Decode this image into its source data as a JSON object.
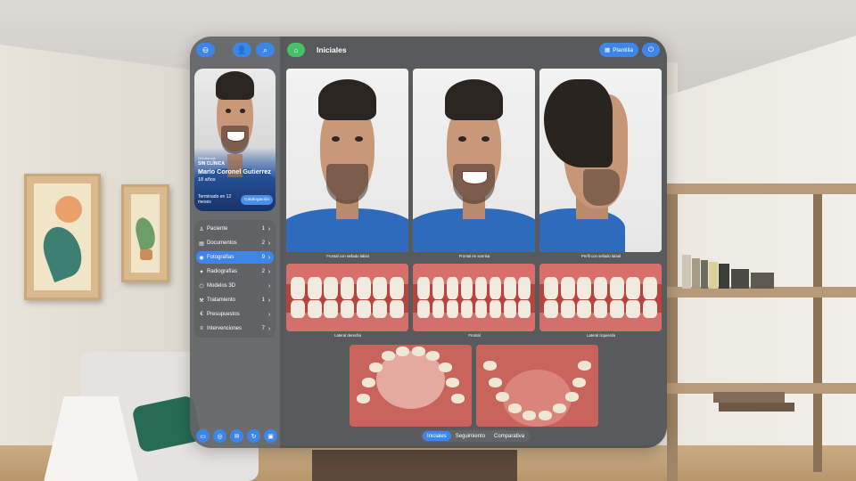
{
  "app": {
    "section_title": "Iniciales",
    "template_button": "Plantilla"
  },
  "patient": {
    "label": "Ortodoncia",
    "clinic": "SIN CLÍNICA",
    "name": "Mario Coronel Gutierrez",
    "age": "18 años",
    "status": "Terminado en 12 meses",
    "catalog_button": "Catalogación"
  },
  "menu": [
    {
      "label": "Paciente",
      "count": "1",
      "icon": "person-icon",
      "active": false
    },
    {
      "label": "Documentos",
      "count": "2",
      "icon": "document-icon",
      "active": false
    },
    {
      "label": "Fotografías",
      "count": "9",
      "icon": "camera-icon",
      "active": true
    },
    {
      "label": "Radiografías",
      "count": "2",
      "icon": "xray-icon",
      "active": false
    },
    {
      "label": "Modelos 3D",
      "count": "",
      "icon": "cube-icon",
      "active": false
    },
    {
      "label": "Tratamiento",
      "count": "1",
      "icon": "wrench-icon",
      "active": false
    },
    {
      "label": "Presupuestos",
      "count": "",
      "icon": "euro-icon",
      "active": false
    },
    {
      "label": "Intervenciones",
      "count": "7",
      "icon": "list-icon",
      "active": false
    }
  ],
  "photos": {
    "row1": [
      "Frontal con sellado labial",
      "Frontal en sonrisa",
      "Perfil con sellado labial"
    ],
    "row2": [
      "Lateral derecha",
      "Frontal",
      "Lateral izquierda"
    ]
  },
  "tabs": [
    {
      "label": "Iniciales",
      "active": true
    },
    {
      "label": "Seguimiento",
      "active": false
    },
    {
      "label": "Comparativa",
      "active": false
    }
  ],
  "colors": {
    "accent": "#3d86e8",
    "home": "#45c065"
  }
}
